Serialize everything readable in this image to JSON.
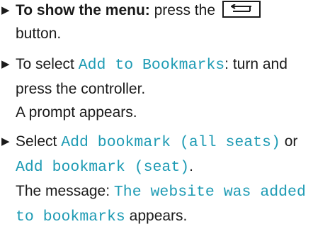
{
  "steps": [
    {
      "lead_bold": "To show the menu:",
      "text_before_icon": " press the",
      "icon": "back-button-icon",
      "text_after_icon": "button."
    },
    {
      "text_1": "To select ",
      "mono_1": "Add to Bookmarks",
      "text_2": ": turn and press the controller.",
      "result": "A prompt appears."
    },
    {
      "text_1": "Select ",
      "mono_1": "Add bookmark (all seats)",
      "text_2": " or ",
      "mono_2": "Add bookmark (seat)",
      "text_3": ".",
      "result_1": "The message: ",
      "result_mono": "The website was added to bookmarks",
      "result_2": " appears."
    }
  ],
  "colors": {
    "text": "#1a1a1a",
    "accent_mono": "#1e9bb4"
  }
}
